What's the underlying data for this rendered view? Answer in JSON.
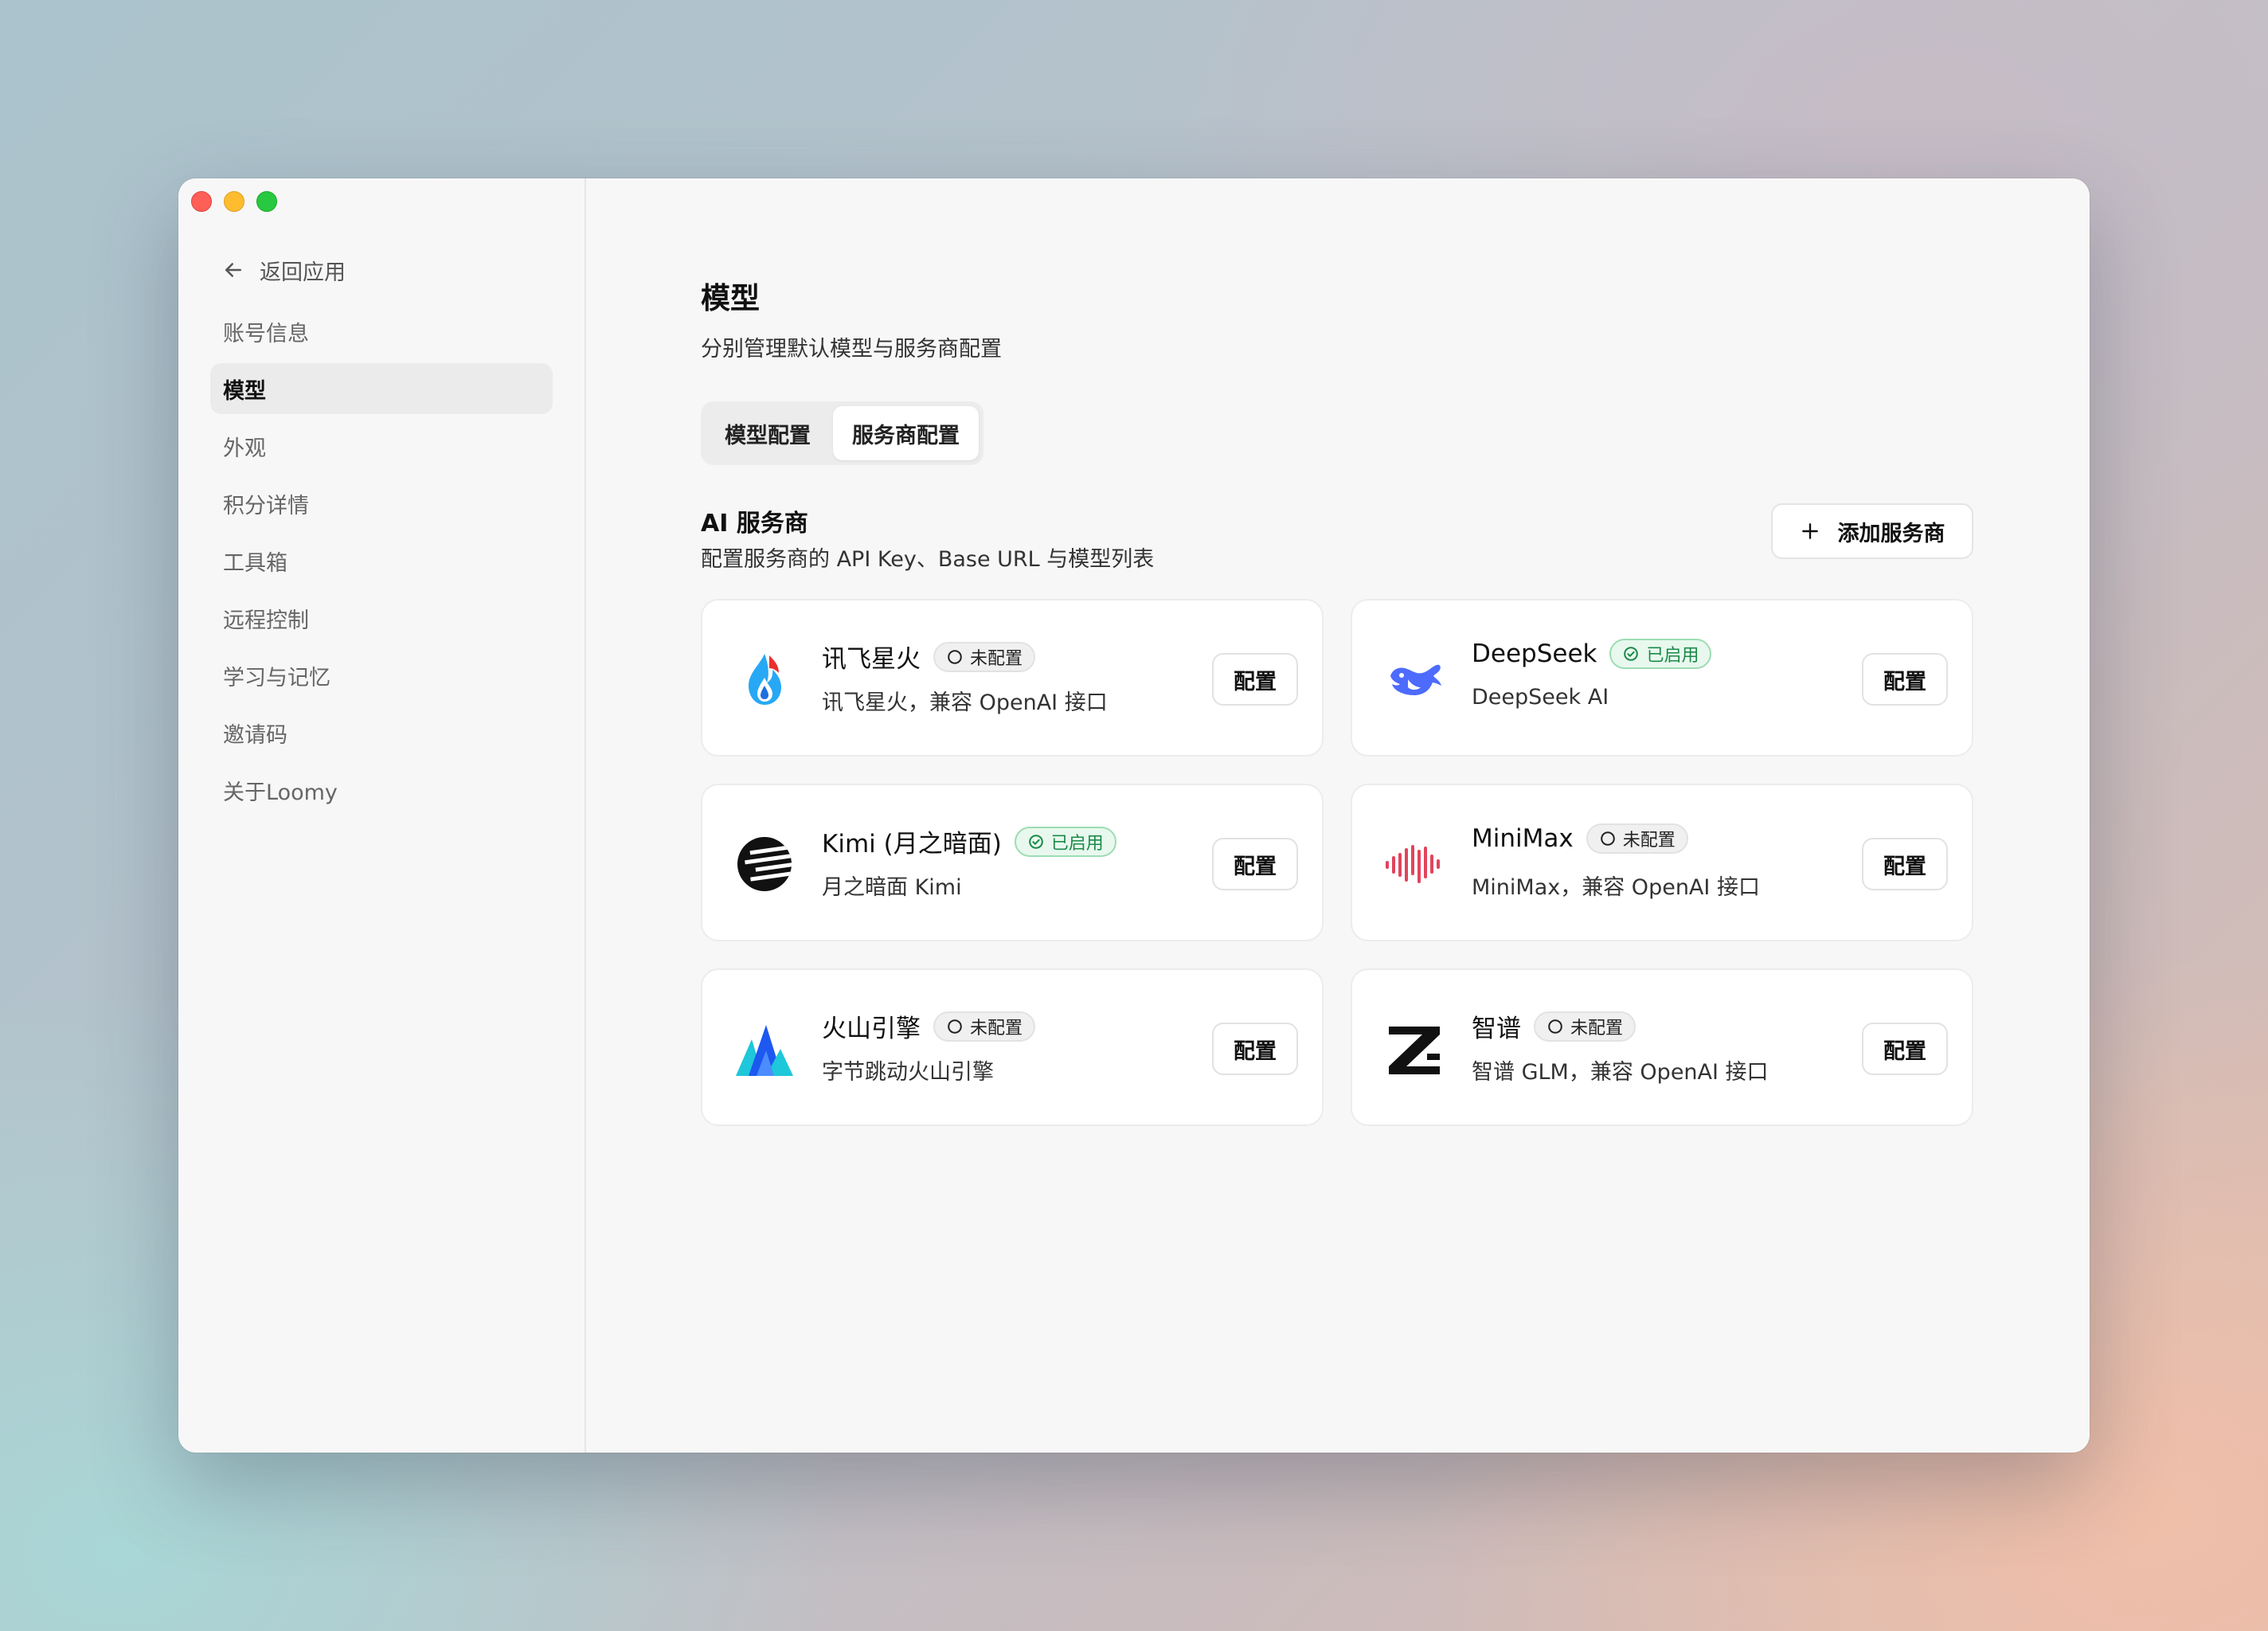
{
  "sidebar": {
    "back_label": "返回应用",
    "items": [
      {
        "label": "账号信息",
        "active": false
      },
      {
        "label": "模型",
        "active": true
      },
      {
        "label": "外观",
        "active": false
      },
      {
        "label": "积分详情",
        "active": false
      },
      {
        "label": "工具箱",
        "active": false
      },
      {
        "label": "远程控制",
        "active": false
      },
      {
        "label": "学习与记忆",
        "active": false
      },
      {
        "label": "邀请码",
        "active": false
      },
      {
        "label": "关于Loomy",
        "active": false
      }
    ]
  },
  "header": {
    "title": "模型",
    "subtitle": "分别管理默认模型与服务商配置"
  },
  "tabs": [
    {
      "label": "模型配置",
      "active": false
    },
    {
      "label": "服务商配置",
      "active": true
    }
  ],
  "section": {
    "title": "AI 服务商",
    "subtitle": "配置服务商的 API Key、Base URL 与模型列表",
    "add_label": "添加服务商"
  },
  "providers": [
    {
      "name": "讯飞星火",
      "status": "未配置",
      "enabled": false,
      "desc": "讯飞星火，兼容 OpenAI 接口",
      "action": "配置",
      "icon": "spark-icon"
    },
    {
      "name": "DeepSeek",
      "status": "已启用",
      "enabled": true,
      "desc": "DeepSeek AI",
      "action": "配置",
      "icon": "whale-icon"
    },
    {
      "name": "Kimi (月之暗面)",
      "status": "已启用",
      "enabled": true,
      "desc": "月之暗面 Kimi",
      "action": "配置",
      "icon": "kimi-icon"
    },
    {
      "name": "MiniMax",
      "status": "未配置",
      "enabled": false,
      "desc": "MiniMax，兼容 OpenAI 接口",
      "action": "配置",
      "icon": "waveform-icon"
    },
    {
      "name": "火山引擎",
      "status": "未配置",
      "enabled": false,
      "desc": "字节跳动火山引擎",
      "action": "配置",
      "icon": "volcano-icon"
    },
    {
      "name": "智谱",
      "status": "未配置",
      "enabled": false,
      "desc": "智谱 GLM，兼容 OpenAI 接口",
      "action": "配置",
      "icon": "zhipu-icon"
    }
  ],
  "colors": {
    "enabled_green": "#1a8a48",
    "deepseek_blue": "#4d6bfe",
    "minimax_red": "#e2445c"
  }
}
